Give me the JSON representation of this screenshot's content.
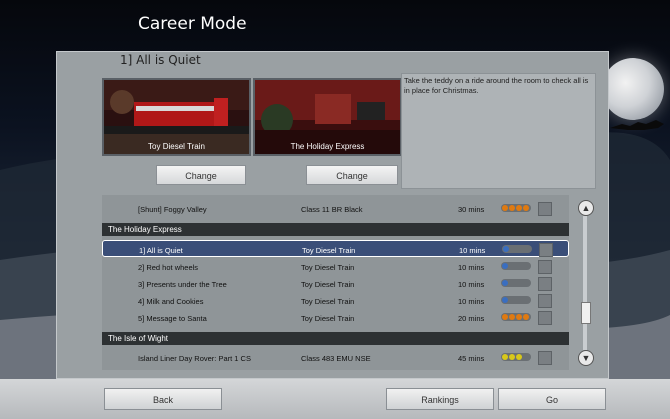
{
  "screen": {
    "title": "Career Mode"
  },
  "scenario": {
    "title": "1] All is Quiet",
    "description": "Take the teddy on a ride around the room to check all is in place for Christmas."
  },
  "thumbnails": [
    {
      "caption": "Toy Diesel Train",
      "button": "Change"
    },
    {
      "caption": "The Holiday Express",
      "button": "Change"
    }
  ],
  "list": {
    "rows": [
      {
        "kind": "row",
        "name": "[Shunt] Foggy Valley",
        "train": "Class 11 BR Black",
        "time": "30 mins",
        "rating": "orange4"
      },
      {
        "kind": "header",
        "label": "The Holiday Express"
      },
      {
        "kind": "row",
        "name": "1] All is Quiet",
        "train": "Toy Diesel Train",
        "time": "10 mins",
        "rating": "blue1",
        "selected": true
      },
      {
        "kind": "row",
        "name": "2] Red hot wheels",
        "train": "Toy Diesel Train",
        "time": "10 mins",
        "rating": "blue1"
      },
      {
        "kind": "row",
        "name": "3] Presents under the Tree",
        "train": "Toy Diesel Train",
        "time": "10 mins",
        "rating": "blue1"
      },
      {
        "kind": "row",
        "name": "4] Milk and Cookies",
        "train": "Toy Diesel Train",
        "time": "10 mins",
        "rating": "blue1"
      },
      {
        "kind": "row",
        "name": "5] Message to Santa",
        "train": "Toy Diesel Train",
        "time": "20 mins",
        "rating": "orange4"
      },
      {
        "kind": "header",
        "label": "The Isle of Wight"
      },
      {
        "kind": "row",
        "name": "Island Liner Day Rover: Part 1 CS",
        "train": "Class 483 EMU NSE",
        "time": "45 mins",
        "rating": "yellow3"
      }
    ]
  },
  "footer": {
    "back": "Back",
    "rankings": "Rankings",
    "go": "Go"
  },
  "colors": {
    "selected_row": "#3a4e78",
    "header_row": "#2d3133",
    "rating_orange": "#e07a10",
    "rating_blue": "#3a6ec0",
    "rating_yellow": "#d8c81a"
  }
}
